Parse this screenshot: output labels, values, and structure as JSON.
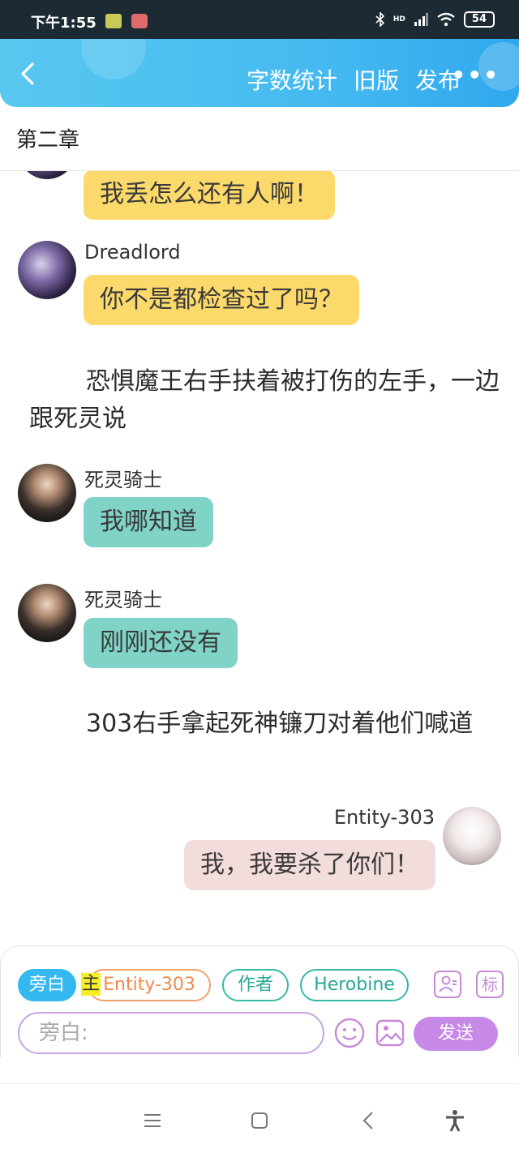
{
  "status_bar": {
    "time": "下午1:55",
    "battery": "54",
    "network": "HD"
  },
  "header": {
    "word_count": "字数统计",
    "old_version": "旧版",
    "publish": "发布",
    "more": "•••"
  },
  "chapter_title": "第二章",
  "messages": [
    {
      "type": "bubble",
      "text": "我丢怎么还有人啊！"
    },
    {
      "type": "chat",
      "speaker": "Dreadlord",
      "text": "你不是都检查过了吗？"
    },
    {
      "type": "narration",
      "text": "恐惧魔王右手扶着被打伤的左手，一边跟死灵说"
    },
    {
      "type": "chat",
      "speaker": "死灵骑士",
      "text": "我哪知道"
    },
    {
      "type": "chat",
      "speaker": "死灵骑士",
      "text": "刚刚还没有"
    },
    {
      "type": "narration",
      "text": "303右手拿起死神镰刀对着他们喊道"
    },
    {
      "type": "chat",
      "speaker": "Entity-303",
      "text": "我，我要杀了你们！"
    }
  ],
  "composer": {
    "role_chips": [
      {
        "label": "旁白",
        "active": true
      },
      {
        "label": "Entity-303",
        "active": false,
        "badge": "主"
      },
      {
        "label": "作者",
        "active": false
      },
      {
        "label": "Herobine",
        "active": false
      }
    ],
    "label_button": "标",
    "input_placeholder": "旁白:",
    "send_label": "发送"
  },
  "colors": {
    "header": "#46baf0",
    "yellow_bubble": "#fbd96a",
    "teal_bubble": "#7fd3c7",
    "pink_bubble": "#f3dcdc",
    "send": "#c689e6"
  }
}
